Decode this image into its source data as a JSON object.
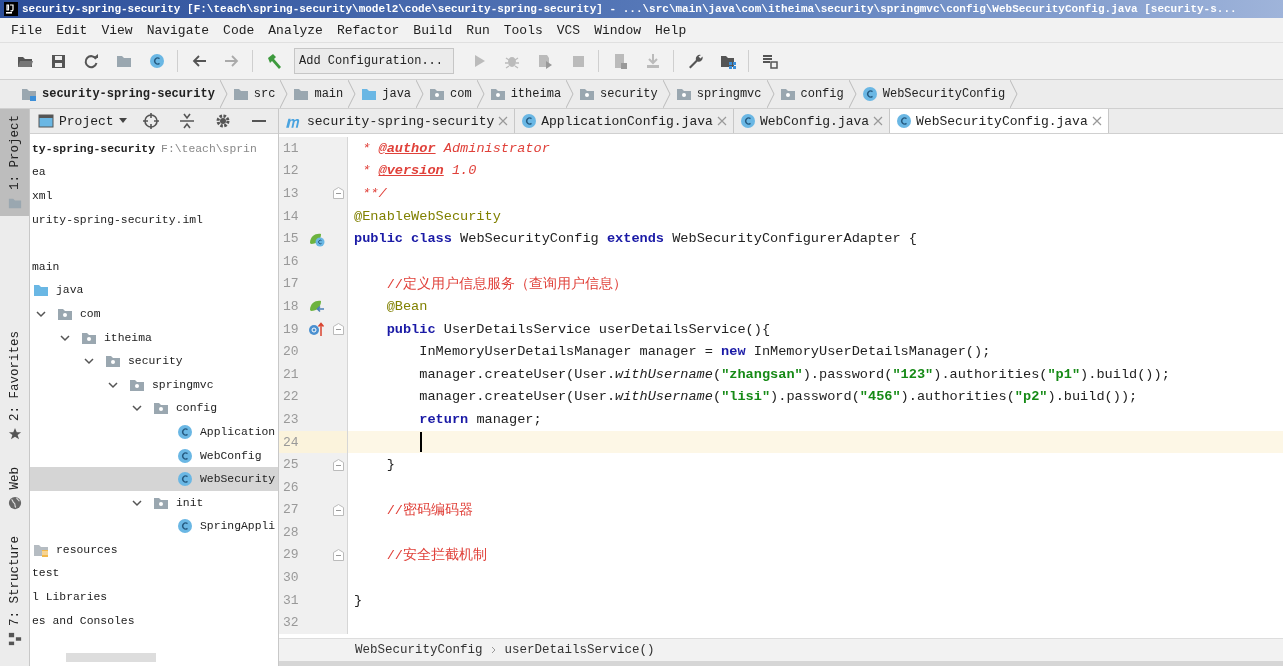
{
  "window": {
    "title": "security-spring-security [F:\\teach\\spring-security\\model2\\code\\security-spring-security] - ...\\src\\main\\java\\com\\itheima\\security\\springmvc\\config\\WebSecurityConfig.java [security-s..."
  },
  "menu": [
    "File",
    "Edit",
    "View",
    "Navigate",
    "Code",
    "Analyze",
    "Refactor",
    "Build",
    "Run",
    "Tools",
    "VCS",
    "Window",
    "Help"
  ],
  "toolbar": {
    "run_configuration": "Add Configuration..."
  },
  "navigation_bar": [
    {
      "label": "security-spring-security",
      "kind": "module"
    },
    {
      "label": "src",
      "kind": "folder"
    },
    {
      "label": "main",
      "kind": "folder"
    },
    {
      "label": "java",
      "kind": "source-folder"
    },
    {
      "label": "com",
      "kind": "package"
    },
    {
      "label": "itheima",
      "kind": "package"
    },
    {
      "label": "security",
      "kind": "package"
    },
    {
      "label": "springmvc",
      "kind": "package"
    },
    {
      "label": "config",
      "kind": "package"
    },
    {
      "label": "WebSecurityConfig",
      "kind": "class"
    }
  ],
  "tool_window_strip": [
    {
      "label": "1: Project",
      "kind": "folder",
      "selected": true
    },
    {
      "label": "2: Favorites",
      "kind": "star",
      "selected": false
    },
    {
      "label": "Web",
      "kind": "globe",
      "selected": false
    },
    {
      "label": "7: Structure",
      "kind": "structure",
      "selected": false
    }
  ],
  "project_panel": {
    "title": "Project",
    "tree": [
      {
        "label": "ty-spring-security",
        "path": "F:\\teach\\sprin",
        "selected": false,
        "children": [
          {
            "label": "ea",
            "selected": false
          },
          {
            "label": "xml",
            "selected": false
          },
          {
            "label": "urity-spring-security.iml",
            "selected": false
          },
          {
            "selected": false,
            "children": [
              {
                "label": "main",
                "selected": false,
                "children": [
                  {
                    "label": "java",
                    "kind": "source-folder",
                    "selected": false,
                    "children": [
                      {
                        "label": "com",
                        "kind": "package",
                        "expanded": true,
                        "selected": false,
                        "children": [
                          {
                            "label": "itheima",
                            "kind": "package",
                            "expanded": true,
                            "selected": false,
                            "children": [
                              {
                                "label": "security",
                                "kind": "package",
                                "expanded": true,
                                "selected": false,
                                "children": [
                                  {
                                    "label": "springmvc",
                                    "kind": "package",
                                    "expanded": true,
                                    "selected": false,
                                    "children": [
                                      {
                                        "label": "config",
                                        "kind": "package",
                                        "expanded": true,
                                        "selected": false,
                                        "children": [
                                          {
                                            "label": "Application",
                                            "kind": "class",
                                            "selected": false
                                          },
                                          {
                                            "label": "WebConfig",
                                            "kind": "class",
                                            "selected": false
                                          },
                                          {
                                            "label": "WebSecurity",
                                            "kind": "class",
                                            "selected": true
                                          }
                                        ]
                                      },
                                      {
                                        "label": "init",
                                        "kind": "package",
                                        "expanded": true,
                                        "selected": false,
                                        "children": [
                                          {
                                            "label": "SpringAppli",
                                            "kind": "class",
                                            "selected": false
                                          }
                                        ]
                                      }
                                    ]
                                  }
                                ]
                              }
                            ]
                          }
                        ]
                      }
                    ]
                  },
                  {
                    "label": "resources",
                    "kind": "resources-folder",
                    "selected": false
                  }
                ]
              },
              {
                "label": "test",
                "selected": false
              }
            ]
          }
        ]
      },
      {
        "label": "l Libraries",
        "selected": false
      },
      {
        "label": "es and Consoles",
        "selected": false
      }
    ]
  },
  "editor_tabs": [
    {
      "label": "security-spring-security",
      "kind": "maven",
      "selected": false
    },
    {
      "label": "ApplicationConfig.java",
      "kind": "class",
      "selected": false
    },
    {
      "label": "WebConfig.java",
      "kind": "class",
      "selected": false
    },
    {
      "label": "WebSecurityConfig.java",
      "kind": "class",
      "selected": true
    }
  ],
  "editor": {
    "lines": [
      {
        "number": "11",
        "fold": false,
        "current": false,
        "tokens": [
          {
            "text": " * ",
            "kind": "doc"
          },
          {
            "text": "@author",
            "kind": "doctag"
          },
          {
            "text": " Administrator",
            "kind": "doc"
          }
        ]
      },
      {
        "number": "12",
        "fold": false,
        "current": false,
        "tokens": [
          {
            "text": " * ",
            "kind": "doc"
          },
          {
            "text": "@version",
            "kind": "doctag"
          },
          {
            "text": " 1.0",
            "kind": "doc"
          }
        ]
      },
      {
        "number": "13",
        "fold": true,
        "current": false,
        "tokens": [
          {
            "text": " **/",
            "kind": "doc"
          }
        ]
      },
      {
        "number": "14",
        "fold": false,
        "current": false,
        "tokens": [
          {
            "text": "@EnableWebSecurity",
            "kind": "annotation"
          }
        ]
      },
      {
        "number": "15",
        "fold": false,
        "current": false,
        "kind": "bean-class",
        "tokens": [
          {
            "text": "public class",
            "kind": "keyword"
          },
          {
            "text": " WebSecurityConfig ",
            "kind": "plain"
          },
          {
            "text": "extends",
            "kind": "keyword"
          },
          {
            "text": " WebSecurityConfigurerAdapter {",
            "kind": "plain"
          }
        ]
      },
      {
        "number": "16",
        "fold": false,
        "current": false
      },
      {
        "number": "17",
        "fold": false,
        "current": false,
        "tokens": [
          {
            "text": "    //定义用户信息服务（查询用户信息）",
            "kind": "comment"
          }
        ]
      },
      {
        "number": "18",
        "fold": false,
        "current": false,
        "kind": "bean",
        "tokens": [
          {
            "text": "    @Bean",
            "kind": "annotation"
          }
        ]
      },
      {
        "number": "19",
        "fold": true,
        "current": false,
        "kind": "implements",
        "tokens": [
          {
            "text": "    public",
            "kind": "keyword"
          },
          {
            "text": " UserDetailsService userDetailsService(){",
            "kind": "plain"
          }
        ]
      },
      {
        "number": "20",
        "fold": false,
        "current": false,
        "tokens": [
          {
            "text": "        InMemoryUserDetailsManager manager = ",
            "kind": "plain"
          },
          {
            "text": "new",
            "kind": "keyword"
          },
          {
            "text": " InMemoryUserDetailsManager();",
            "kind": "plain"
          }
        ]
      },
      {
        "number": "21",
        "fold": false,
        "current": false,
        "tokens": [
          {
            "text": "        manager.createUser(User.",
            "kind": "plain"
          },
          {
            "text": "withUsername",
            "kind": "static"
          },
          {
            "text": "(",
            "kind": "plain"
          },
          {
            "text": "\"zhangsan\"",
            "kind": "string"
          },
          {
            "text": ").password(",
            "kind": "plain"
          },
          {
            "text": "\"123\"",
            "kind": "string"
          },
          {
            "text": ").authorities(",
            "kind": "plain"
          },
          {
            "text": "\"p1\"",
            "kind": "string"
          },
          {
            "text": ").build());",
            "kind": "plain"
          }
        ]
      },
      {
        "number": "22",
        "fold": false,
        "current": false,
        "tokens": [
          {
            "text": "        manager.createUser(User.",
            "kind": "plain"
          },
          {
            "text": "withUsername",
            "kind": "static"
          },
          {
            "text": "(",
            "kind": "plain"
          },
          {
            "text": "\"lisi\"",
            "kind": "string"
          },
          {
            "text": ").password(",
            "kind": "plain"
          },
          {
            "text": "\"456\"",
            "kind": "string"
          },
          {
            "text": ").authorities(",
            "kind": "plain"
          },
          {
            "text": "\"p2\"",
            "kind": "string"
          },
          {
            "text": ").build());",
            "kind": "plain"
          }
        ]
      },
      {
        "number": "23",
        "fold": false,
        "current": false,
        "tokens": [
          {
            "text": "        return",
            "kind": "keyword"
          },
          {
            "text": " manager;",
            "kind": "plain"
          }
        ]
      },
      {
        "number": "24",
        "fold": false,
        "current": true
      },
      {
        "number": "25",
        "fold": true,
        "current": false,
        "tokens": [
          {
            "text": "    }",
            "kind": "plain"
          }
        ]
      },
      {
        "number": "26",
        "fold": false,
        "current": false
      },
      {
        "number": "27",
        "fold": true,
        "current": false,
        "tokens": [
          {
            "text": "    //密码编码器",
            "kind": "comment"
          }
        ]
      },
      {
        "number": "28",
        "fold": false,
        "current": false
      },
      {
        "number": "29",
        "fold": true,
        "current": false,
        "tokens": [
          {
            "text": "    //安全拦截机制",
            "kind": "comment"
          }
        ]
      },
      {
        "number": "30",
        "fold": false,
        "current": false
      },
      {
        "number": "31",
        "fold": false,
        "current": false,
        "tokens": [
          {
            "text": "}",
            "kind": "plain"
          }
        ]
      },
      {
        "number": "32",
        "fold": false,
        "current": false
      }
    ],
    "breadcrumb": [
      "WebSecurityConfig",
      "userDetailsService()"
    ]
  }
}
